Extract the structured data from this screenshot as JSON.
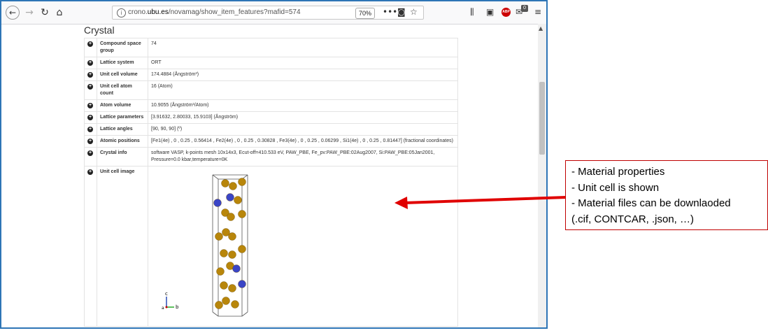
{
  "browser": {
    "url_host": "crono.",
    "url_domain": "ubu.es",
    "url_path": "/novamag/show_item_features?mafid=574",
    "zoom": "70%",
    "notifications_count": "0",
    "adblock_label": "ABP"
  },
  "page": {
    "heading": "Crystal",
    "rows": [
      {
        "key": "Compound space group",
        "value": "74"
      },
      {
        "key": "Lattice system",
        "value": "ORT"
      },
      {
        "key": "Unit cell volume",
        "value": "174.4884 (Ångström³)"
      },
      {
        "key": "Unit cell atom count",
        "value": "16 (Atom)"
      },
      {
        "key": "Atom volume",
        "value": "10.9055 (Ångström³/Atom)"
      },
      {
        "key": "Lattice parameters",
        "value": "[3.91632, 2.80033, 15.9103] (Ångström)"
      },
      {
        "key": "Lattice angles",
        "value": "[90, 90, 90] (º)"
      },
      {
        "key": "Atomic positions",
        "value": "[Fe1(4e) , 0 , 0.25 , 0.56414 , Fe2(4e) , 0 , 0.25 , 0.30828 , Fe3(4e) , 0 , 0.25 , 0.06299 , Si1(4e) , 0 , 0.25 , 0.81447] (fractional coordinates)"
      },
      {
        "key": "Crystal info",
        "value": "software VASP, k-points mesh 10x14x3, Ecut-off=410.533 eV, PAW_PBE, Fe_pv:PAW_PBE:02Aug2007, Si:PAW_PBE:05Jan2001, Pressure=0.0 kbar,temperature=0K"
      },
      {
        "key": "Unit cell image",
        "value": ""
      }
    ],
    "axes": {
      "c": "c",
      "a": "a",
      "b": "b"
    },
    "colors": {
      "fe_atom": "#b8860b",
      "si_atom": "#3a45c6"
    }
  },
  "annotation": {
    "lines": [
      "- Material properties",
      "- Unit cell is shown",
      "- Material files can be downlaoded",
      "(.cif, CONTCAR, .json, …)"
    ],
    "border_color": "#c00000",
    "arrow_color": "#e00000"
  }
}
